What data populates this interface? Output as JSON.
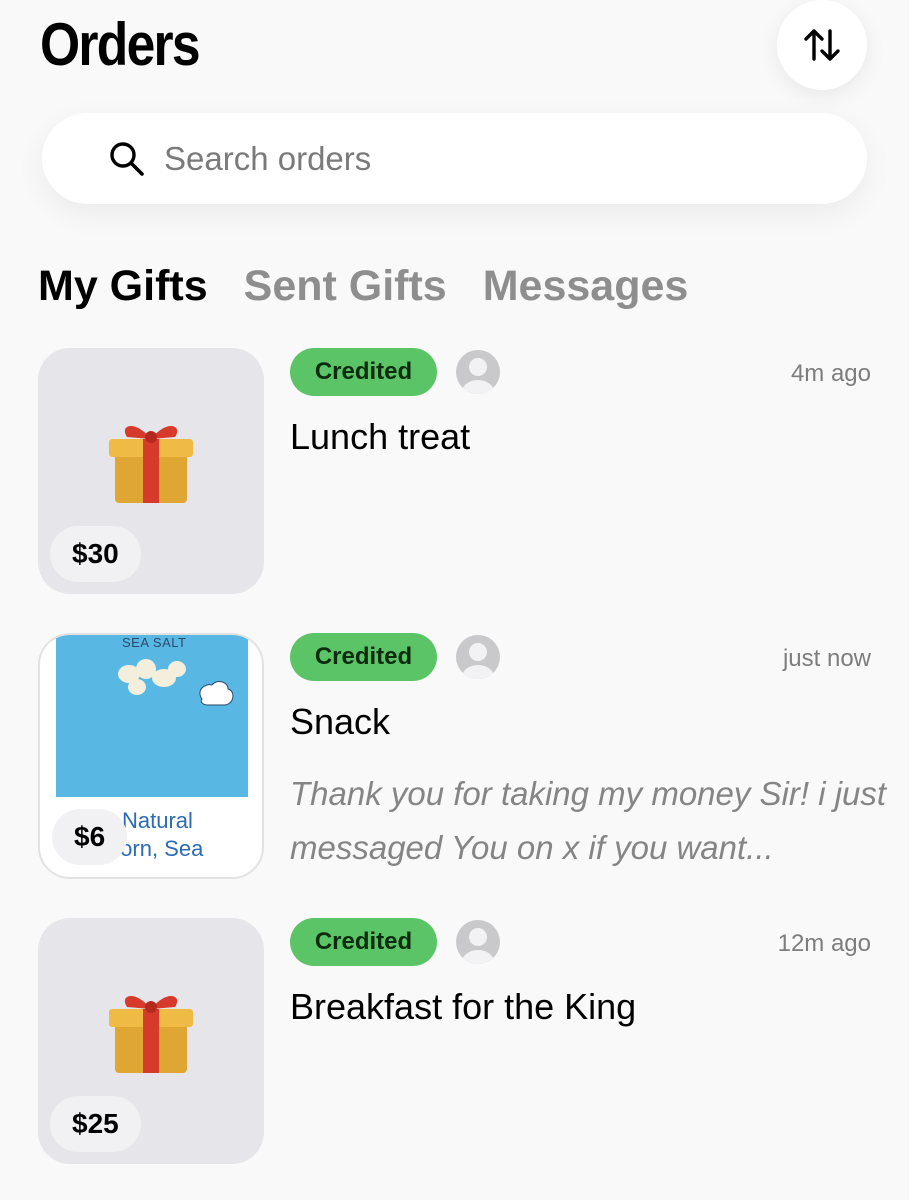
{
  "header": {
    "title": "Orders",
    "sort_icon": "sort-arrows-icon"
  },
  "search": {
    "placeholder": "Search orders",
    "icon": "search-icon"
  },
  "tabs": [
    {
      "label": "My Gifts",
      "active": true
    },
    {
      "label": "Sent Gifts",
      "active": false
    },
    {
      "label": "Messages",
      "active": false
    }
  ],
  "orders": [
    {
      "status": "Credited",
      "time": "4m ago",
      "name": "Lunch treat",
      "price": "$30",
      "thumbnail": "gift-icon",
      "message": ""
    },
    {
      "status": "Credited",
      "time": "just now",
      "name": "Snack",
      "price": "$6",
      "thumbnail": "popcorn-bag-image",
      "product_image_text": {
        "top_label": "SEA SALT",
        "caption_line1": "Natural",
        "caption_line2": "Popcorn, Sea"
      },
      "message": "Thank you for taking my money Sir! i just messaged You on x if you want..."
    },
    {
      "status": "Credited",
      "time": "12m ago",
      "name": "Breakfast for the King",
      "price": "$25",
      "thumbnail": "gift-icon",
      "message": ""
    }
  ],
  "colors": {
    "background": "#f9f9f9",
    "badge_green": "#5bc466",
    "inactive_tab": "#8e8e8e",
    "muted_text": "#7d7d7d"
  }
}
